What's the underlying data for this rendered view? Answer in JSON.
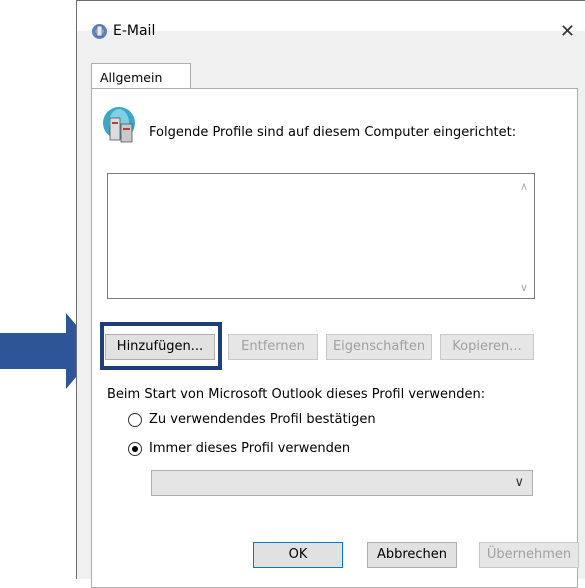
{
  "window": {
    "title": "E-Mail",
    "close_glyph": "✕"
  },
  "tabs": [
    {
      "label": "Allgemein"
    }
  ],
  "info_text": "Folgende Profile sind auf diesem Computer eingerichtet:",
  "profile_list": {
    "items": []
  },
  "buttons": {
    "add": "Hinzufügen...",
    "remove": "Entfernen",
    "properties": "Eigenschaften",
    "copy": "Kopieren..."
  },
  "startup_label": "Beim Start von Microsoft Outlook dieses Profil verwenden:",
  "radio_options": [
    {
      "label": "Zu verwendendes Profil bestätigen",
      "checked": false
    },
    {
      "label": "Immer dieses Profil verwenden",
      "checked": true
    }
  ],
  "profile_select": {
    "value": ""
  },
  "footer": {
    "ok": "OK",
    "cancel": "Abbrechen",
    "apply": "Übernehmen"
  },
  "colors": {
    "highlight": "#1f3f7a",
    "arrow": "#2e5597",
    "accent": "#0078d7"
  },
  "icons": {
    "title": "mail-profile-icon",
    "profiles": "profiles-computer-icon"
  }
}
